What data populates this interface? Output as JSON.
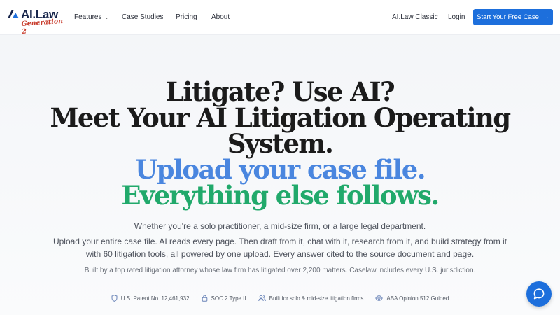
{
  "brand": {
    "name": "AI.Law",
    "tagline": "Generation 2"
  },
  "nav": {
    "items": [
      {
        "label": "Features",
        "has_dropdown": true
      },
      {
        "label": "Case Studies"
      },
      {
        "label": "Pricing"
      },
      {
        "label": "About"
      }
    ],
    "classic_link": "AI.Law Classic",
    "login": "Login",
    "cta_label": "Start Your Free Case"
  },
  "hero": {
    "line1": "Litigate? Use AI?",
    "line2": "Meet Your AI Litigation Operating",
    "line3": "System.",
    "line4": "Upload your case file.",
    "line5": "Everything else follows.",
    "subtitle": "Whether you're a solo practitioner, a mid-size firm, or a large legal department.",
    "description_line1": "Upload your entire case file. AI reads every page. Then draft from it, chat with it, research from it, and build strategy from it",
    "description_line2": "with 60 litigation tools, all powered by one upload. Every answer cited to the source document and page.",
    "credibility": "Built by a top rated litigation attorney whose law firm has litigated over 2,200 matters. Caselaw includes every U.S. jurisdiction."
  },
  "badges": [
    {
      "icon": "shield-icon",
      "label": "U.S. Patent No. 12,461,932"
    },
    {
      "icon": "lock-icon",
      "label": "SOC 2 Type II"
    },
    {
      "icon": "users-icon",
      "label": "Built for solo & mid-size litigation firms"
    },
    {
      "icon": "eye-icon",
      "label": "ABA Opinion 512 Guided"
    }
  ],
  "chat": {
    "icon": "chat-bubble-icon"
  },
  "colors": {
    "accent": "#1d6fdc",
    "headline_blue": "#4a86df",
    "headline_green": "#21a96b",
    "brand_navy": "#16244a",
    "brand_red": "#c83c2c"
  }
}
